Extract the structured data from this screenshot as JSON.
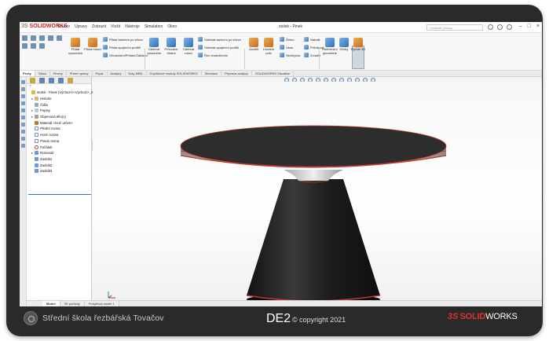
{
  "titlebar": {
    "brand": "SOLIDWORKS",
    "brand_prefix": "3S",
    "menus": [
      "Soubor",
      "Úpravy",
      "Zobrazit",
      "Vložit",
      "Nástroje",
      "Simulation",
      "Okno"
    ],
    "document_title": "stolek - Pinek",
    "search_placeholder": "Vyhledat příkazy"
  },
  "ribbon": {
    "big_buttons": [
      {
        "label": "Přidat vysunutím"
      },
      {
        "label": "Přidat rotací"
      },
      {
        "label": "Odebrat vysunutím"
      },
      {
        "label": "Průvodce dírami"
      },
      {
        "label": "Odebrat rotací"
      },
      {
        "label": "Zaoblit"
      },
      {
        "label": "Lineární pole"
      },
      {
        "label": "Žebro"
      },
      {
        "label": "Úkos"
      },
      {
        "label": "Skořepina"
      },
      {
        "label": "Referenční geometrie"
      },
      {
        "label": "Křivky"
      },
      {
        "label": "Rychlé 3D"
      }
    ],
    "rows": [
      "Přidat tažením po křivce",
      "Přidat spojením profilů",
      "Ohraničení/Přidání/Základu",
      "Odebrat tažením po křivce",
      "Odebrat spojením profilů",
      "Řez ohraničením",
      "Nabalit",
      "Průnikové",
      "Zrcadlit"
    ]
  },
  "tabs": [
    "Prvky",
    "Skica",
    "Plochy",
    "Přímé úpravy",
    "Popis",
    "Analýzy",
    "Kóty MBD",
    "Doplňkové moduly SOLIDWORKS",
    "Simulace",
    "Příprava analýzy",
    "SOLIDWORKS Visualize"
  ],
  "active_tab": "Prvky",
  "feature_tree": {
    "filter_icon": "filter-icon",
    "items": [
      {
        "text": "stolek - Pinek (Výchozí<<Výchozí>_Z",
        "icon": "part",
        "indent": 0,
        "exp": ""
      },
      {
        "text": "Historie",
        "icon": "folder",
        "indent": 1,
        "exp": "▸"
      },
      {
        "text": "Čidla",
        "icon": "sensor",
        "indent": 1,
        "exp": ""
      },
      {
        "text": "Popisy",
        "icon": "note",
        "indent": 1,
        "exp": "▸"
      },
      {
        "text": "Objemová tělo(1)",
        "icon": "solid",
        "indent": 1,
        "exp": "▸"
      },
      {
        "text": "Materiál <není určen>",
        "icon": "mat",
        "indent": 1,
        "exp": ""
      },
      {
        "text": "Přední rovina",
        "icon": "plane",
        "indent": 1,
        "exp": ""
      },
      {
        "text": "Horní rovina",
        "icon": "plane",
        "indent": 1,
        "exp": ""
      },
      {
        "text": "Pravá rovina",
        "icon": "plane",
        "indent": 1,
        "exp": ""
      },
      {
        "text": "Počátek",
        "icon": "origin",
        "indent": 1,
        "exp": ""
      },
      {
        "text": "Rotovat3",
        "icon": "feat",
        "indent": 1,
        "exp": "▸"
      },
      {
        "text": "Zaoblit1",
        "icon": "feat",
        "indent": 1,
        "exp": ""
      },
      {
        "text": "Zaoblit2",
        "icon": "feat",
        "indent": 1,
        "exp": ""
      },
      {
        "text": "Zaoblit3",
        "icon": "feat",
        "indent": 1,
        "exp": ""
      }
    ]
  },
  "bottom_tabs": [
    "Model",
    "3D pohledy",
    "Pohybová studie 1"
  ],
  "active_bottom_tab": "Model",
  "footer": {
    "school": "Střední škola řezbářská Tovačov",
    "title": "DE2",
    "copyright": "© copyright 2021",
    "brand_prefix": "3S",
    "brand_bold": "SOLID",
    "brand_rest": "WORKS"
  },
  "colors": {
    "accent_red": "#d71920",
    "table_top": "#2d2d2d",
    "table_rim": "#c8c8c8",
    "table_edge": "#c0392b",
    "table_base": "#1f1f1f",
    "table_neck": "#d7d7d7"
  }
}
